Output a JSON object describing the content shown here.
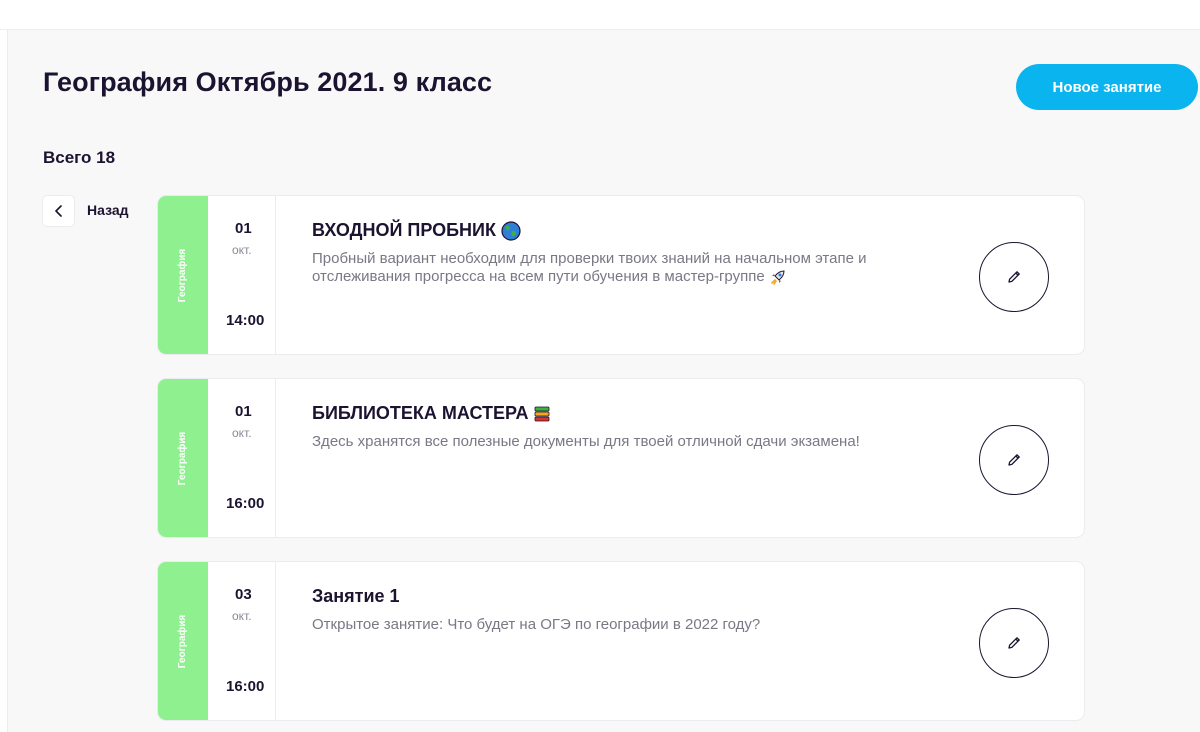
{
  "header": {
    "title": "География Октябрь 2021. 9 класс",
    "new_lesson_label": "Новое занятие"
  },
  "summary": {
    "total_label": "Всего 18"
  },
  "nav": {
    "back_label": "Назад"
  },
  "colors": {
    "accent": "#0ab4ee",
    "subject_strip": "#8ef08e",
    "background": "#f8f8f9"
  },
  "lessons": [
    {
      "subject": "География",
      "day": "01",
      "month": "окт.",
      "time": "14:00",
      "title": "ВХОДНОЙ ПРОБНИК",
      "title_icon": "globe-icon",
      "description": "Пробный вариант необходим для проверки твоих знаний на начальном этапе и отслеживания прогресса на всем пути обучения в мастер-группе",
      "description_icon": "rocket-icon"
    },
    {
      "subject": "География",
      "day": "01",
      "month": "окт.",
      "time": "16:00",
      "title": "БИБЛИОТЕКА МАСТЕРА",
      "title_icon": "books-icon",
      "description": "Здесь хранятся все полезные документы для твоей отличной сдачи экзамена!"
    },
    {
      "subject": "География",
      "day": "03",
      "month": "окт.",
      "time": "16:00",
      "title": "Занятие 1",
      "description": "Открытое занятие: Что будет на ОГЭ по географии в 2022 году?"
    }
  ]
}
